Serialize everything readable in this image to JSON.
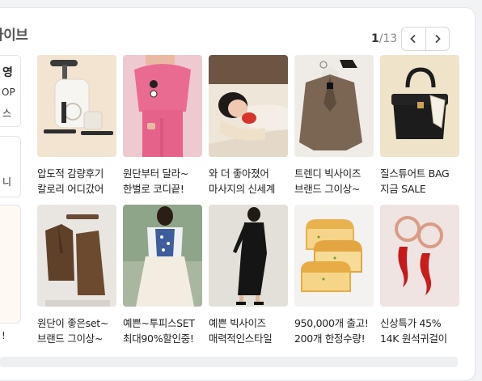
{
  "section": {
    "title": "라이브",
    "pager": {
      "current": "1",
      "total": "/13"
    }
  },
  "left_partial": {
    "card1": {
      "line1": "영",
      "line2": "OP",
      "line3": "스"
    },
    "card2": {
      "line1": "니"
    },
    "card3": {
      "line1": "!"
    }
  },
  "products": [
    {
      "line1": "압도적 감량후기",
      "line2": "칼로리 어디갔어",
      "image": "exercise-bike-image"
    },
    {
      "line1": "원단부터 달라~",
      "line2": "한벌로 코디끝!",
      "image": "pink-outfit-image"
    },
    {
      "line1": "와 더 좋아졌어",
      "line2": "마사지의 신세계",
      "image": "neck-massager-image"
    },
    {
      "line1": "트렌디 빅사이즈",
      "line2": "브랜드 그이상~",
      "image": "brown-blazer-image"
    },
    {
      "line1": "질스튜어트 BAG",
      "line2": "지금 SALE",
      "image": "black-handbag-image"
    },
    {
      "line1": "원단이 좋은set~",
      "line2": "브랜드 그이상~",
      "image": "brown-set-image"
    },
    {
      "line1": "예쁜~투피스SET",
      "line2": "최대90%할인중!",
      "image": "floral-twopiece-image"
    },
    {
      "line1": "예쁜 빅사이즈",
      "line2": "매력적인스타일",
      "image": "black-dress-image"
    },
    {
      "line1": "950,000개 출고!",
      "line2": "200개 한정수량!",
      "image": "toast-image"
    },
    {
      "line1": "신상특가 45%",
      "line2": "14K 원석귀걸이",
      "image": "red-earrings-image"
    }
  ]
}
